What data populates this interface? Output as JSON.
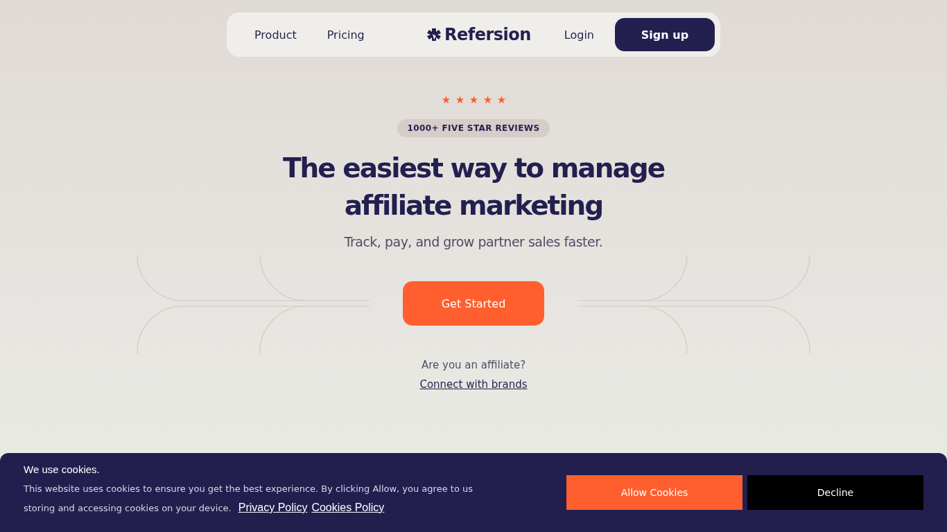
{
  "nav": {
    "links": [
      {
        "label": "Product"
      },
      {
        "label": "Pricing"
      }
    ],
    "logo": "Refersion",
    "login": "Login",
    "signup": "Sign up"
  },
  "hero": {
    "stars": 5,
    "badge": "1000+ FIVE STAR REVIEWS",
    "title_lines": [
      "The easiest way to manage",
      "affiliate marketing"
    ],
    "subtitle": "Track, pay, and grow partner sales faster.",
    "cta": "Get Started",
    "affiliate_question": "Are you an affiliate?",
    "affiliate_link": "Connect with brands"
  },
  "cookie_banner": {
    "title": "We use cookies.",
    "text": "This website uses cookies to ensure you get the best experience. By clicking Allow, you agree to us storing and accessing cookies on your device.",
    "links": [
      "Privacy Policy",
      "Cookies Policy"
    ],
    "allow": "Allow Cookies",
    "decline": "Decline"
  }
}
